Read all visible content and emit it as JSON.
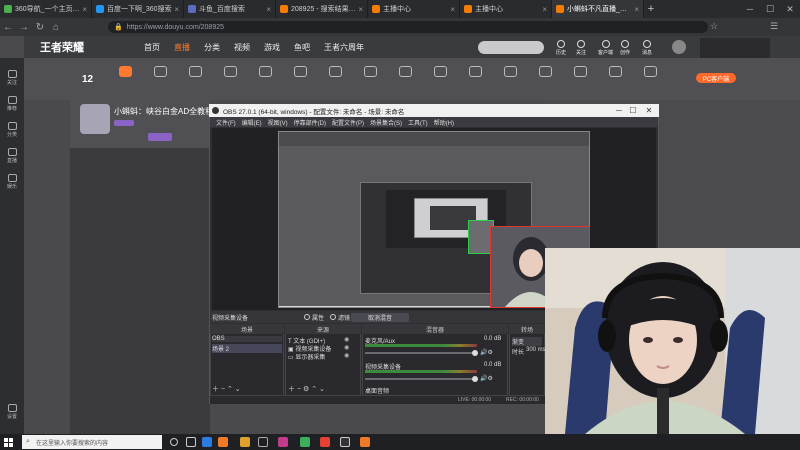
{
  "browser": {
    "tabs": [
      {
        "title": "360导航_一个主页，整个世界",
        "color": "#4caf50"
      },
      {
        "title": "百度一下啊_360搜索",
        "color": "#2196f3"
      },
      {
        "title": "斗鱼_百度搜索",
        "color": "#5c6bc0"
      },
      {
        "title": "208925 - 搜索结果 - 斗鱼直播",
        "color": "#f57c00"
      },
      {
        "title": "主播中心",
        "color": "#f57c00"
      },
      {
        "title": "主播中心",
        "color": "#f57c00"
      },
      {
        "title": "小蝌蚪不凡直播_蝌蚪家族直播",
        "color": "#f57c00",
        "active": true
      }
    ],
    "url": "https://www.douyu.com/208925",
    "new_tab": "+"
  },
  "douyu": {
    "logo": "王者荣耀",
    "nav": [
      "首页",
      "直播",
      "分类",
      "视频",
      "游戏",
      "鱼吧",
      "王者六周年"
    ],
    "right_icons": [
      "历史",
      "关注",
      "客户端",
      "创作",
      "消息"
    ],
    "gifts": [
      "",
      "",
      "",
      "",
      "",
      "",
      "",
      "",
      "",
      "",
      "",
      "",
      "",
      "",
      "",
      "",
      "",
      "",
      ""
    ],
    "count": "12",
    "room_title": "小蝌蚪：峡谷白金AD全教程",
    "pc_badge": "PC客户端",
    "left_items": [
      "关注",
      "推荐",
      "分类",
      "直播",
      "娱乐",
      "设置"
    ]
  },
  "obs": {
    "title": "OBS 27.0.1 (64-bit, windows) - 配置文件: 未命名 - 场景: 未命名",
    "menu": [
      "文件(F)",
      "编辑(E)",
      "视图(V)",
      "停靠部件(D)",
      "配置文件(P)",
      "场景集合(S)",
      "工具(T)",
      "帮助(H)"
    ],
    "toolbar": {
      "source_label": "视频采集设备",
      "props": "属性",
      "filters": "滤镜",
      "transition": "取消混音"
    },
    "docks": {
      "scenes": {
        "title": "场景",
        "items": [
          "OBS",
          "场景 2"
        ]
      },
      "sources": {
        "title": "来源",
        "items": [
          "文本 (GDI+)",
          "视频采集设备",
          "显示器采集"
        ]
      },
      "mixer": {
        "title": "混音器",
        "ch1": "麦克风/Aux",
        "ch1_db": "0.0 dB",
        "ch2": "视频采集设备",
        "ch2_db": "0.0 dB",
        "ch3": "桌面音频"
      },
      "transitions": {
        "title": "转场",
        "value": "渐变",
        "duration_label": "时长",
        "duration": "300 ms"
      }
    },
    "status": {
      "live": "LIVE: 00:00:00",
      "rec": "REC: 00:00:00"
    }
  },
  "taskbar": {
    "search_placeholder": "在这里输入你要搜索的内容"
  }
}
